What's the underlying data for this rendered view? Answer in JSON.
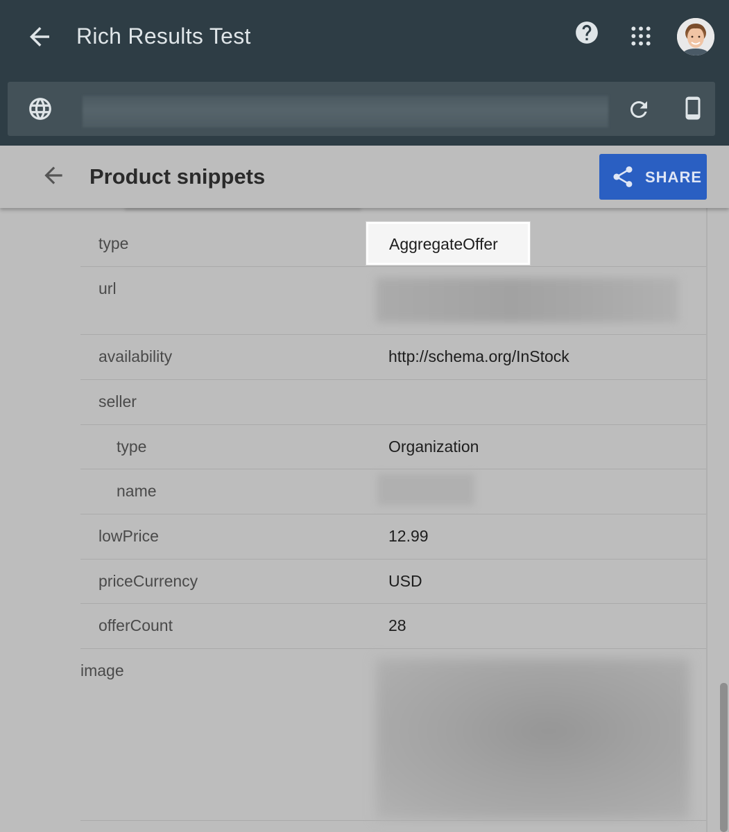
{
  "app": {
    "title": "Rich Results Test"
  },
  "urlbar": {
    "url_value": "",
    "url_placeholder": ""
  },
  "panel": {
    "title": "Product snippets",
    "share_label": "SHARE",
    "accent_color": "#2a5fc2"
  },
  "properties": [
    {
      "key": "type",
      "value": "AggregateOffer",
      "highlighted": true
    },
    {
      "key": "url",
      "value": ""
    },
    {
      "key": "availability",
      "value": "http://schema.org/InStock"
    },
    {
      "key": "seller",
      "value": ""
    },
    {
      "key": "type",
      "value": "Organization",
      "nested": true
    },
    {
      "key": "name",
      "value": "",
      "nested": true
    },
    {
      "key": "lowPrice",
      "value": "12.99"
    },
    {
      "key": "priceCurrency",
      "value": "USD"
    },
    {
      "key": "offerCount",
      "value": "28"
    },
    {
      "key": "image",
      "value": ""
    }
  ],
  "icons": [
    "back-arrow-icon",
    "help-icon",
    "apps-grid-icon",
    "avatar",
    "globe-icon",
    "reload-icon",
    "mobile-device-icon",
    "share-icon"
  ]
}
